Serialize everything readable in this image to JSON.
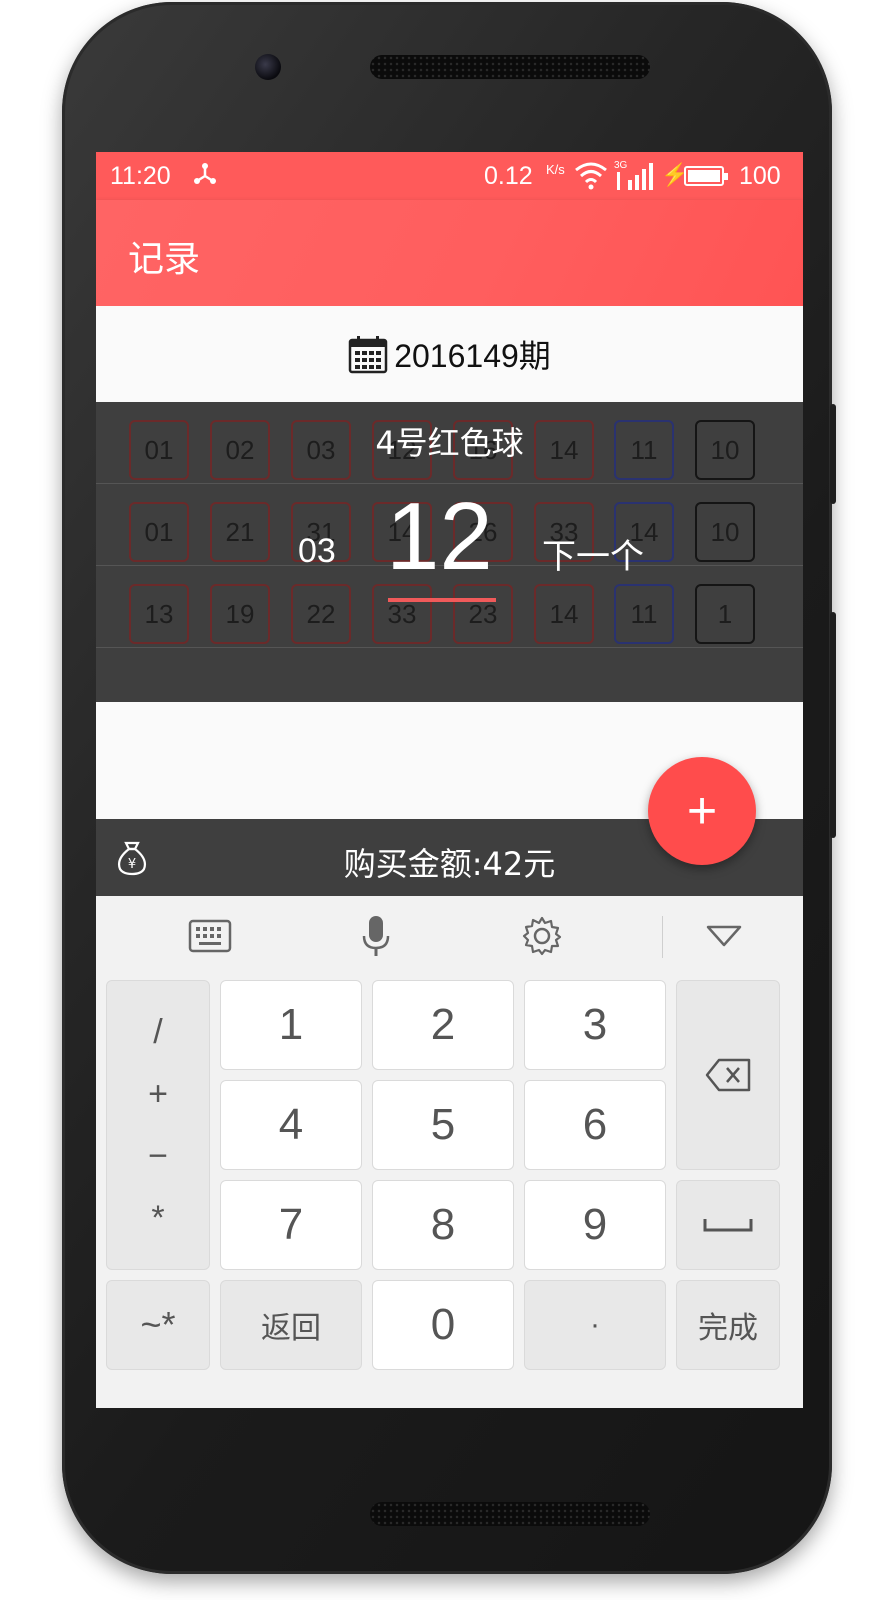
{
  "status_bar": {
    "time": "11:20",
    "usb_icon": "usb-icon",
    "speed": "0.12",
    "speed_unit": "K/s",
    "wifi_icon": "wifi-icon",
    "network_label": "3G",
    "charging_icon": "bolt-icon",
    "battery_level": "100"
  },
  "toolbar": {
    "title": "记录"
  },
  "period": {
    "icon": "calendar-icon",
    "text": "2016149期"
  },
  "ticket_rows": [
    {
      "red": [
        "01",
        "02",
        "03",
        "12",
        "16"
      ],
      "blue": [
        "14",
        "11"
      ],
      "extra": "10"
    },
    {
      "red": [
        "01",
        "21",
        "31",
        "14",
        "26"
      ],
      "blue": [
        "33",
        "14"
      ],
      "extra": "10"
    },
    {
      "red": [
        "13",
        "19",
        "22",
        "33",
        "23"
      ],
      "blue": [
        "14",
        "11"
      ],
      "extra": "1"
    }
  ],
  "picker": {
    "title": "4号红色球",
    "previous_value": "03",
    "current_value": "12",
    "next_label": "下一个"
  },
  "amount": {
    "icon": "money-bag-icon",
    "text": "购买金额:42元"
  },
  "fab": {
    "label": "+",
    "icon": "add-icon"
  },
  "keyboard": {
    "toolbar_icons": [
      "keyboard-icon",
      "microphone-icon",
      "settings-icon",
      "collapse-icon"
    ],
    "symbols": [
      "/",
      "+",
      "−",
      "*"
    ],
    "digits": [
      "1",
      "2",
      "3",
      "4",
      "5",
      "6",
      "7",
      "8",
      "9",
      "0"
    ],
    "tilde_key": "~*",
    "back_key": "返回",
    "dot_key": "·",
    "done_key": "完成",
    "backspace_icon": "backspace-icon",
    "space_icon": "space-icon"
  },
  "colors": {
    "accent": "#ff5a5a",
    "fab": "#ff4c4c",
    "dark_panel": "#3f3f3f",
    "red_ball_border": "#6b2a2a",
    "blue_ball_border": "#2a3270"
  }
}
